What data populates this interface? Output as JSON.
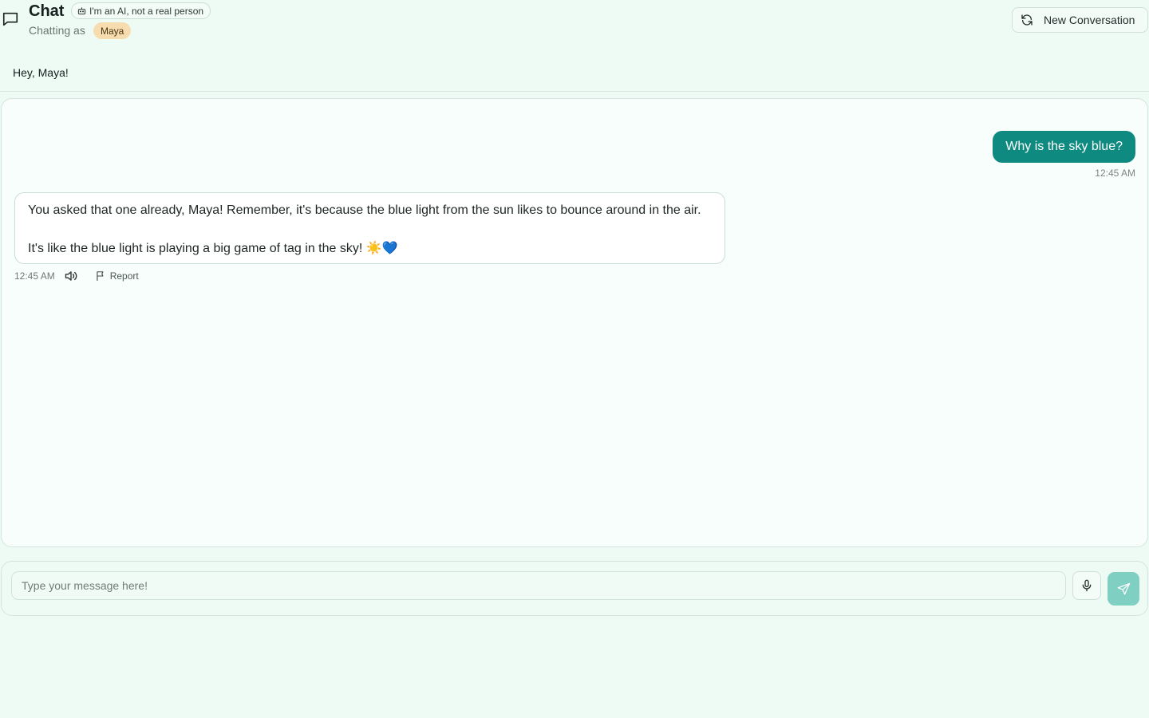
{
  "header": {
    "title": "Chat",
    "ai_badge": "I'm an AI, not a real person",
    "chatting_as_label": "Chatting as",
    "user_name": "Maya",
    "new_conversation_label": "New Conversation"
  },
  "greeting": "Hey, Maya!",
  "messages": [
    {
      "role": "user",
      "text": "Why is the sky blue?",
      "time": "12:45 AM"
    },
    {
      "role": "assistant",
      "paragraphs": [
        "You asked that one already, Maya! Remember, it's because the blue light from the sun likes to bounce around in the air.",
        "It's like the blue light is playing a big game of tag in the sky! ☀️💙"
      ],
      "time": "12:45 AM",
      "report_label": "Report"
    }
  ],
  "composer": {
    "placeholder": "Type your message here!",
    "value": ""
  },
  "icons": {
    "chat": "message-square-icon",
    "ai_badge": "bot-icon",
    "new_conversation": "refresh-icon",
    "speaker": "volume-icon",
    "report": "flag-icon",
    "mic": "microphone-icon",
    "send": "send-icon"
  },
  "colors": {
    "background": "#eefbf4",
    "accent": "#0f8a80",
    "send_button": "#7fcfc3",
    "user_pill": "#f6dcae"
  }
}
